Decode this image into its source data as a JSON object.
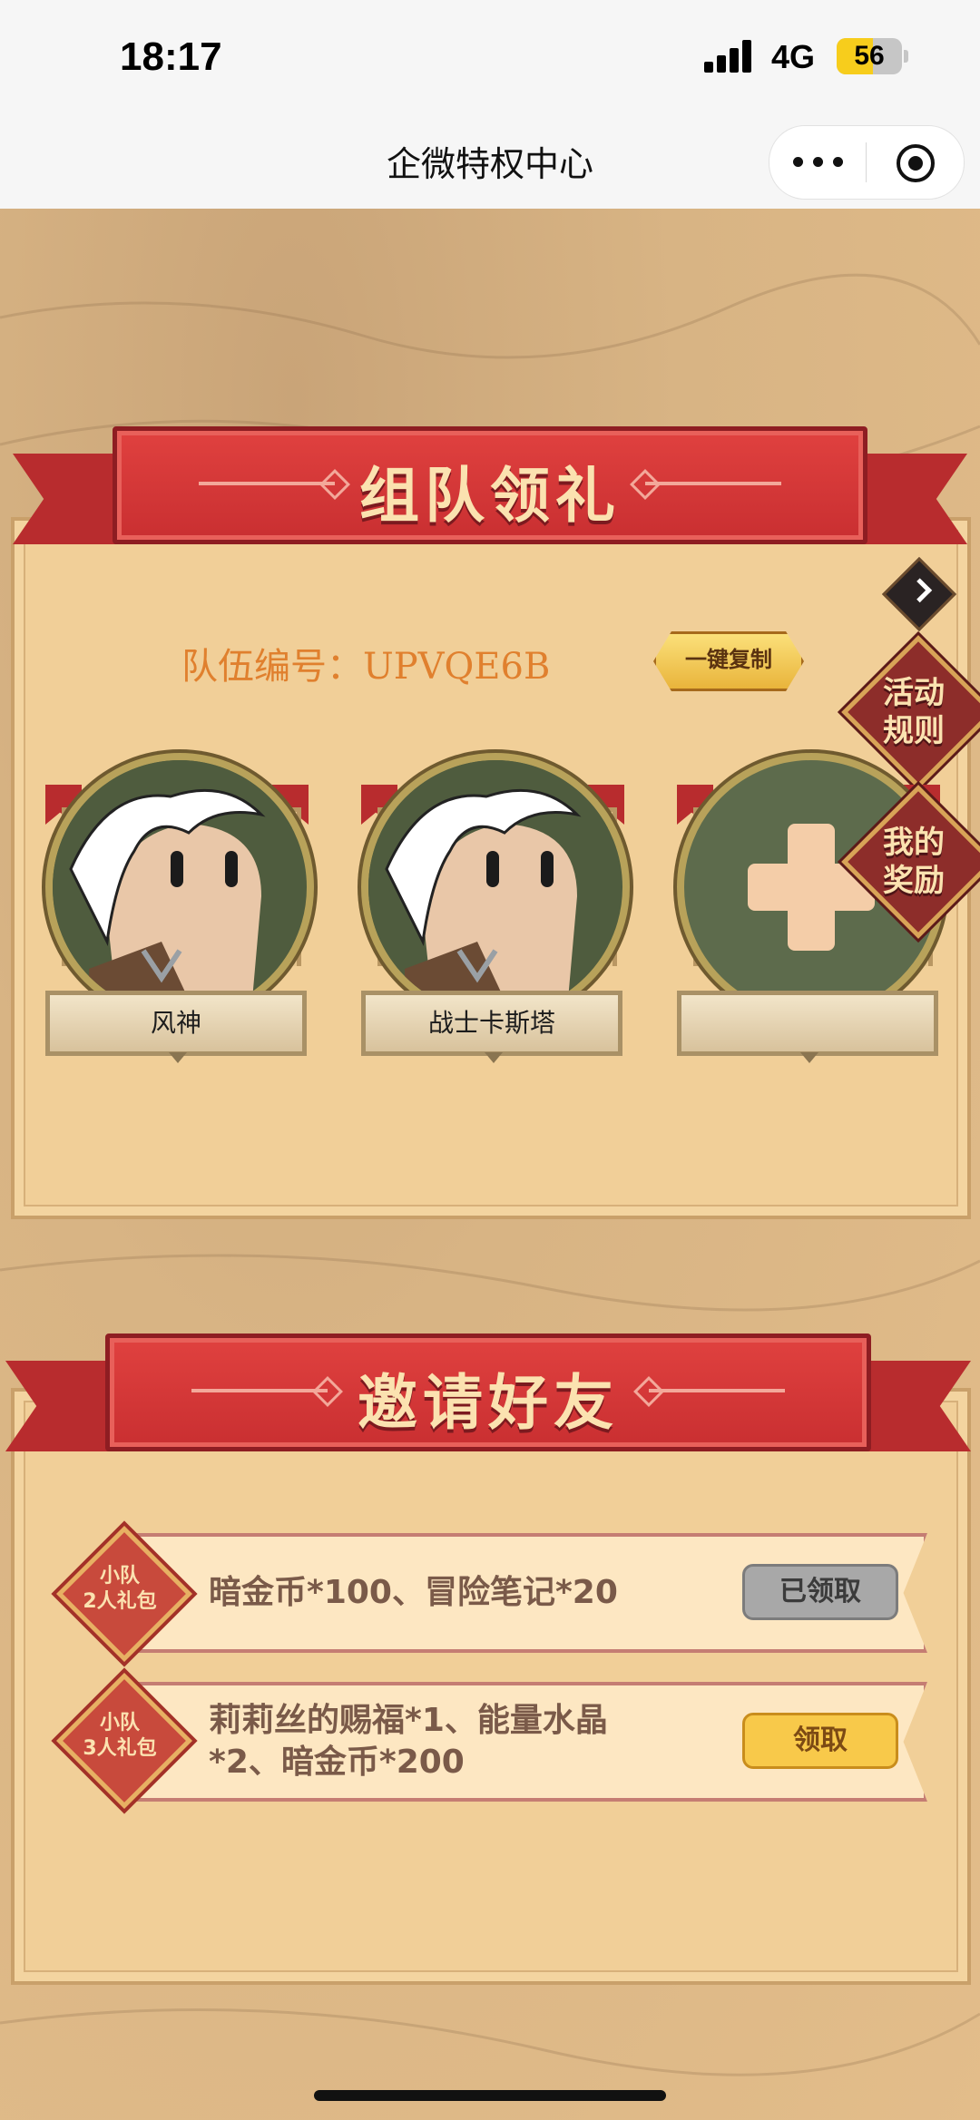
{
  "status": {
    "time": "18:17",
    "network": "4G",
    "battery": "56",
    "battery_level": 0.56
  },
  "nav": {
    "title": "企微特权中心",
    "more_icon": "more-dots-icon",
    "close_icon": "target-close-icon"
  },
  "team": {
    "banner": "组队领礼",
    "team_number_label": "队伍编号：UPVQE6B",
    "copy_button": "一键复制",
    "members": [
      {
        "name": "风神",
        "avatar": "warrior-avatar"
      },
      {
        "name": "战士卡斯塔",
        "avatar": "warrior-avatar"
      },
      {
        "name": "",
        "avatar": "add-member-plus-icon"
      }
    ]
  },
  "side": {
    "rules_label": "活动\n规则",
    "rewards_label": "我的\n奖励"
  },
  "invite": {
    "banner": "邀请好友",
    "rewards": [
      {
        "badge": "小队\n2人礼包",
        "description": "暗金币*100、冒险笔记*20",
        "button": "已领取",
        "status": "claimed"
      },
      {
        "badge": "小队\n3人礼包",
        "description": "莉莉丝的赐福*1、能量水晶*2、暗金币*200",
        "button": "领取",
        "status": "available"
      }
    ]
  },
  "colors": {
    "banner_red": "#c92f31",
    "panel": "#f1cf98",
    "accent_orange": "#e0802e",
    "claim_yellow": "#f8c94a",
    "claimed_gray": "#a8a8a8"
  }
}
